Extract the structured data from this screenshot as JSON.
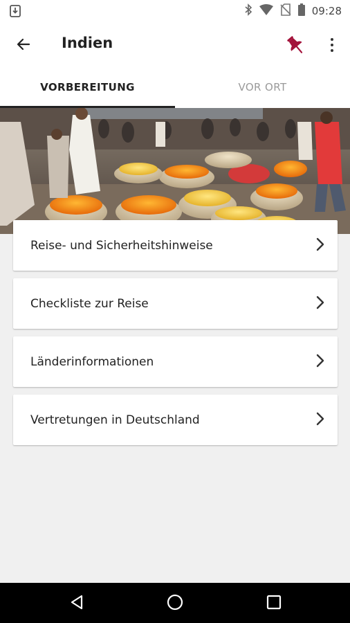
{
  "status_bar": {
    "time": "09:28",
    "icons": [
      "download-icon",
      "bluetooth-icon",
      "wifi-icon",
      "no-sim-icon",
      "battery-icon"
    ]
  },
  "app_bar": {
    "title": "Indien",
    "back_icon": "arrow-back-icon",
    "pin_icon": "pushpin-icon",
    "more_icon": "more-vertical-icon",
    "pin_color": "#a3123a"
  },
  "tabs": [
    {
      "label": "VORBEREITUNG",
      "active": true
    },
    {
      "label": "VOR ORT",
      "active": false
    }
  ],
  "hero": {
    "image": "market-photo"
  },
  "menu_items": [
    {
      "label": "Reise- und Sicherheitshinweise"
    },
    {
      "label": "Checkliste zur Reise"
    },
    {
      "label": "Länderinformationen"
    },
    {
      "label": "Vertretungen in Deutschland"
    }
  ],
  "nav_bar": {
    "icons": [
      "back-triangle-icon",
      "home-circle-icon",
      "recents-square-icon"
    ]
  }
}
